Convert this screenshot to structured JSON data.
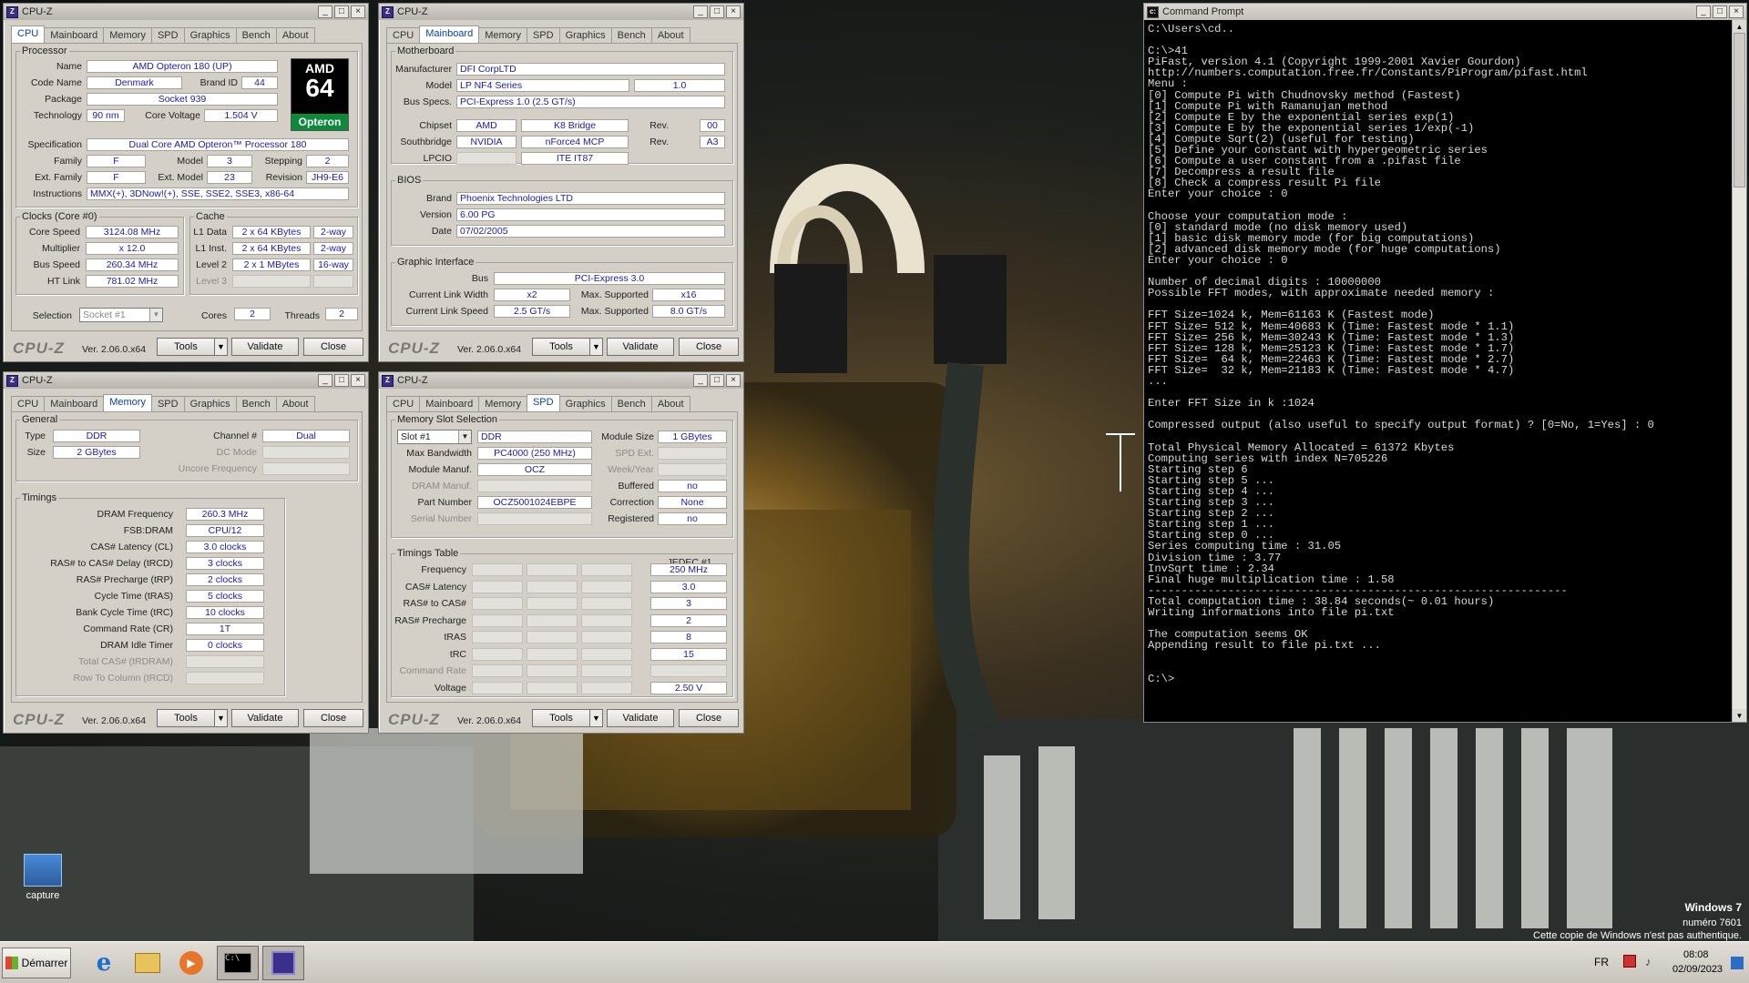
{
  "w1": {
    "title": "CPU-Z",
    "tabs": [
      "CPU",
      "Mainboard",
      "Memory",
      "SPD",
      "Graphics",
      "Bench",
      "About"
    ],
    "proc_label": "Processor",
    "name_l": "Name",
    "name": "AMD Opteron 180 (UP)",
    "codename_l": "Code Name",
    "codename": "Denmark",
    "brandid_l": "Brand ID",
    "brandid": "44",
    "package_l": "Package",
    "package": "Socket 939",
    "tech_l": "Technology",
    "tech": "90 nm",
    "volt_l": "Core Voltage",
    "volt": "1.504 V",
    "spec_l": "Specification",
    "spec": "Dual Core AMD Opteron™ Processor 180",
    "family_l": "Family",
    "family": "F",
    "model_l": "Model",
    "model": "3",
    "stepping_l": "Stepping",
    "stepping": "2",
    "extfam_l": "Ext. Family",
    "extfam": "F",
    "extmod_l": "Ext. Model",
    "extmod": "23",
    "rev_l": "Revision",
    "rev": "JH9-E6",
    "instr_l": "Instructions",
    "instr": "MMX(+), 3DNow!(+), SSE, SSE2, SSE3, x86-64",
    "amd_logo": {
      "l1": "AMD",
      "l2": "64",
      "l3": "Opteron"
    },
    "clocks_label": "Clocks (Core #0)",
    "cs_l": "Core Speed",
    "cs": "3124.08 MHz",
    "mul_l": "Multiplier",
    "mul": "x 12.0",
    "bus_l": "Bus Speed",
    "bus": "260.34 MHz",
    "ht_l": "HT Link",
    "ht": "781.02 MHz",
    "cache_label": "Cache",
    "l1d_l": "L1 Data",
    "l1d": "2 x 64 KBytes",
    "l1d_w": "2-way",
    "l1i_l": "L1 Inst.",
    "l1i": "2 x 64 KBytes",
    "l1i_w": "2-way",
    "l2_l": "Level 2",
    "l2": "2 x 1 MBytes",
    "l2_w": "16-way",
    "l3_l": "Level 3",
    "selection_l": "Selection",
    "selection": "Socket #1",
    "cores_l": "Cores",
    "cores": "2",
    "threads_l": "Threads",
    "threads": "2"
  },
  "w2": {
    "title": "CPU-Z",
    "tabs": [
      "CPU",
      "Mainboard",
      "Memory",
      "SPD",
      "Graphics",
      "Bench",
      "About"
    ],
    "mb_label": "Motherboard",
    "manuf_l": "Manufacturer",
    "manuf": "DFI CorpLTD",
    "model_l": "Model",
    "model": "LP NF4 Series",
    "model_rev": "1.0",
    "busspec_l": "Bus Specs.",
    "busspec": "PCI-Express 1.0 (2.5 GT/s)",
    "chipset_l": "Chipset",
    "chipset": "AMD",
    "chipset2": "K8 Bridge",
    "rev_l": "Rev.",
    "chipset_rev": "00",
    "sb_l": "Southbridge",
    "sb": "NVIDIA",
    "sb2": "nForce4 MCP",
    "sb_rev": "A3",
    "lpcio_l": "LPCIO",
    "lpcio": "ITE IT87",
    "bios_label": "BIOS",
    "brand_l": "Brand",
    "brand": "Phoenix Technologies LTD",
    "version_l": "Version",
    "version": "6.00 PG",
    "date_l": "Date",
    "date": "07/02/2005",
    "gi_label": "Graphic Interface",
    "gbus_l": "Bus",
    "gbus": "PCI-Express 3.0",
    "clw_l": "Current Link Width",
    "clw": "x2",
    "mlw_l": "Max. Supported",
    "mlw": "x16",
    "cls_l": "Current Link Speed",
    "cls": "2.5 GT/s",
    "mls_l": "Max. Supported",
    "mls": "8.0 GT/s"
  },
  "w3": {
    "title": "CPU-Z",
    "tabs": [
      "CPU",
      "Mainboard",
      "Memory",
      "SPD",
      "Graphics",
      "Bench",
      "About"
    ],
    "gen_label": "General",
    "type_l": "Type",
    "type": "DDR",
    "size_l": "Size",
    "size": "2 GBytes",
    "chan_l": "Channel #",
    "chan": "Dual",
    "dcmode_l": "DC Mode",
    "uncore_l": "Uncore Frequency",
    "tim_label": "Timings",
    "dram_l": "DRAM Frequency",
    "dram": "260.3 MHz",
    "fsb_l": "FSB:DRAM",
    "fsb": "CPU/12",
    "cl_l": "CAS# Latency (CL)",
    "cl": "3.0 clocks",
    "trcd_l": "RAS# to CAS# Delay (tRCD)",
    "trcd": "3 clocks",
    "trp_l": "RAS# Precharge (tRP)",
    "trp": "2 clocks",
    "tras_l": "Cycle Time (tRAS)",
    "tras": "5 clocks",
    "trc_l": "Bank Cycle Time (tRC)",
    "trc": "10 clocks",
    "cr_l": "Command Rate (CR)",
    "cr": "1T",
    "idle_l": "DRAM Idle Timer",
    "idle": "0 clocks",
    "tcas_l": "Total CAS# (tRDRAM)",
    "rtc_l": "Row To Column (tRCD)"
  },
  "w4": {
    "title": "CPU-Z",
    "tabs": [
      "CPU",
      "Mainboard",
      "Memory",
      "SPD",
      "Graphics",
      "Bench",
      "About"
    ],
    "slot_label": "Memory Slot Selection",
    "slot": "Slot #1",
    "slot_type": "DDR",
    "modsize_l": "Module Size",
    "modsize": "1 GBytes",
    "maxbw_l": "Max Bandwidth",
    "maxbw": "PC4000 (250 MHz)",
    "spdext_l": "SPD Ext.",
    "modman_l": "Module Manuf.",
    "modman": "OCZ",
    "week_l": "Week/Year",
    "dramman_l": "DRAM Manuf.",
    "buffered_l": "Buffered",
    "buffered": "no",
    "part_l": "Part Number",
    "part": "OCZ5001024EBPE",
    "corr_l": "Correction",
    "corr": "None",
    "serial_l": "Serial Number",
    "reg_l": "Registered",
    "reg": "no",
    "tt_label": "Timings Table",
    "jedec": "JEDEC #1",
    "freq_l": "Frequency",
    "freq": "250 MHz",
    "cas_l": "CAS# Latency",
    "cas": "3.0",
    "rtc_l": "RAS# to CAS#",
    "rtc": "3",
    "rp_l": "RAS# Precharge",
    "rp": "2",
    "tras_l": "tRAS",
    "tras": "8",
    "trc_l": "tRC",
    "trc": "15",
    "cmdrate_l": "Command Rate",
    "volt_l": "Voltage",
    "volt": "2.50 V"
  },
  "common": {
    "logo": "CPU-Z",
    "ver": "Ver. 2.06.0.x64",
    "tools": "Tools",
    "validate": "Validate",
    "close": "Close"
  },
  "cmd": {
    "title": "Command Prompt",
    "text": "C:\\Users\\cd..\n\nC:\\>41\nPiFast, version 4.1 (Copyright 1999-2001 Xavier Gourdon)\nhttp://numbers.computation.free.fr/Constants/PiProgram/pifast.html\nMenu :\n[0] Compute Pi with Chudnovsky method (Fastest)\n[1] Compute Pi with Ramanujan method\n[2] Compute E by the exponential series exp(1)\n[3] Compute E by the exponential series 1/exp(-1)\n[4] Compute Sqrt(2) (useful for testing)\n[5] Define your constant with hypergeometric series\n[6] Compute a user constant from a .pifast file\n[7] Decompress a result file\n[8] Check a compress result Pi file\nEnter your choice : 0\n\nChoose your computation mode :\n[0] standard mode (no disk memory used)\n[1] basic disk memory mode (for big computations)\n[2] advanced disk memory mode (for huge computations)\nEnter your choice : 0\n\nNumber of decimal digits : 10000000\nPossible FFT modes, with approximate needed memory :\n\nFFT Size=1024 k, Mem=61163 K (Fastest mode)\nFFT Size= 512 k, Mem=40683 K (Time: Fastest mode * 1.1)\nFFT Size= 256 k, Mem=30243 K (Time: Fastest mode * 1.3)\nFFT Size= 128 k, Mem=25123 K (Time: Fastest mode * 1.7)\nFFT Size=  64 k, Mem=22463 K (Time: Fastest mode * 2.7)\nFFT Size=  32 k, Mem=21183 K (Time: Fastest mode * 4.7)\n...\n\nEnter FFT Size in k :1024\n\nCompressed output (also useful to specify output format) ? [0=No, 1=Yes] : 0\n\nTotal Physical Memory Allocated = 61372 Kbytes\nComputing series with index N=705226\nStarting step 6\nStarting step 5 ...\nStarting step 4 ...\nStarting step 3 ...\nStarting step 2 ...\nStarting step 1 ...\nStarting step 0 ...\nSeries computing time : 31.05\nDivision time : 3.77\nInvSqrt time : 2.34\nFinal huge multiplication time : 1.58\n---------------------------------------------------------------\nTotal computation time : 38.84 seconds(~ 0.01 hours)\nWriting informations into file pi.txt\n\nThe computation seems OK\nAppending result to file pi.txt ...\n\n\nC:\\>"
  },
  "desktop": {
    "icon_label": "capture"
  },
  "watermark": {
    "l1": "Windows 7",
    "l2": "numéro 7601",
    "l3": "Cette copie de Windows n'est pas authentique."
  },
  "taskbar": {
    "start": "Démarrer",
    "lang": "FR",
    "time": "08:08",
    "date": "02/09/2023"
  }
}
